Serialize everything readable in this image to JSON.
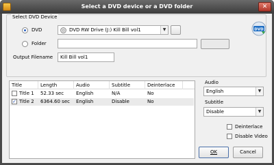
{
  "window": {
    "title": "Select a DVD device or a DVD folder"
  },
  "group": {
    "legend": "Select DVD Device"
  },
  "source": {
    "dvd_label": "DVD",
    "dvd_selected": true,
    "dvd_value": "DVD RW Drive (J:) Kill Bill vol1",
    "folder_label": "Folder",
    "folder_selected": false,
    "folder_value": "",
    "browse_small_label": "",
    "browse_folder_label": "",
    "output_label": "Output Filename",
    "output_value": "Kill Bill vol1"
  },
  "titles_list": {
    "columns": [
      "Title",
      "Length",
      "Audio",
      "Subtitle",
      "Deinterlace"
    ],
    "rows": [
      {
        "title": "Title 1",
        "length": "52.33 sec",
        "audio": "English",
        "subtitle": "N/A",
        "deinterlace": "No",
        "checked": false,
        "selected": false
      },
      {
        "title": "Title 2",
        "length": "6364.60 sec",
        "audio": "English",
        "subtitle": "Disable",
        "deinterlace": "No",
        "checked": true,
        "selected": true
      }
    ]
  },
  "options": {
    "audio_label": "Audio",
    "audio_value": "English",
    "subtitle_label": "Subtitle",
    "subtitle_value": "Disable",
    "deinterlace_label": "Deinterlace",
    "deinterlace_checked": false,
    "disable_video_label": "Disable Video",
    "disable_video_checked": false
  },
  "buttons": {
    "ok": "OK",
    "cancel": "Cancel"
  },
  "icons": {
    "window_icon": "dvd-app-icon",
    "drive_icon": "cd-drive-icon",
    "logo_icon": "dvd-logo-icon"
  },
  "colors": {
    "titlebar": "#4a4a4a",
    "selected_row": "#eaeaea",
    "radio_dot": "#2a5fbf"
  }
}
